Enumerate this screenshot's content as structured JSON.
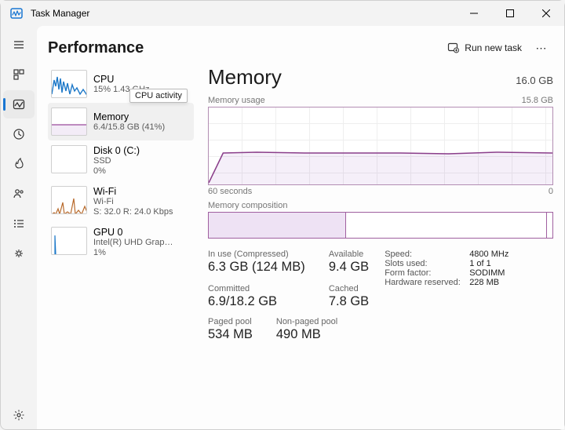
{
  "window": {
    "title": "Task Manager"
  },
  "page": {
    "heading": "Performance",
    "runNewTask": "Run new task",
    "tooltip": "CPU activity"
  },
  "cards": {
    "cpu": {
      "name": "CPU",
      "sub1": "15% 1.43 GHz"
    },
    "mem": {
      "name": "Memory",
      "sub1": "6.4/15.8 GB (41%)"
    },
    "disk": {
      "name": "Disk 0 (C:)",
      "sub1": "SSD",
      "sub2": "0%"
    },
    "wifi": {
      "name": "Wi-Fi",
      "sub1": "Wi-Fi",
      "sub2": "S: 32.0 R: 24.0 Kbps"
    },
    "gpu": {
      "name": "GPU 0",
      "sub1": "Intel(R) UHD Grap…",
      "sub2": "1%"
    }
  },
  "memory": {
    "title": "Memory",
    "total": "16.0 GB",
    "usageLabel": "Memory usage",
    "max": "15.8 GB",
    "axisLeft": "60 seconds",
    "axisRight": "0",
    "compLabel": "Memory composition",
    "compUsedPct": 40,
    "stats": {
      "inUseLabel": "In use (Compressed)",
      "inUse": "6.3 GB (124 MB)",
      "availableLabel": "Available",
      "available": "9.4 GB",
      "committedLabel": "Committed",
      "committed": "6.9/18.2 GB",
      "cachedLabel": "Cached",
      "cached": "7.8 GB",
      "pagedLabel": "Paged pool",
      "paged": "534 MB",
      "nonpagedLabel": "Non-paged pool",
      "nonpaged": "490 MB"
    },
    "specs": {
      "speedK": "Speed:",
      "speedV": "4800 MHz",
      "slotsK": "Slots used:",
      "slotsV": "1 of 1",
      "ffK": "Form factor:",
      "ffV": "SODIMM",
      "hwresK": "Hardware reserved:",
      "hwresV": "228 MB"
    }
  },
  "chart_data": {
    "type": "line",
    "title": "Memory usage",
    "xlabel": "60 seconds → 0",
    "ylabel": "GB",
    "ylim": [
      0,
      15.8
    ],
    "x": [
      60,
      55,
      50,
      45,
      40,
      35,
      30,
      25,
      20,
      15,
      10,
      5,
      0
    ],
    "series": [
      {
        "name": "Memory in use (GB)",
        "values": [
          0.2,
          6.3,
          6.4,
          6.4,
          6.4,
          6.4,
          6.4,
          6.4,
          6.4,
          6.3,
          6.4,
          6.4,
          6.4
        ]
      }
    ]
  }
}
